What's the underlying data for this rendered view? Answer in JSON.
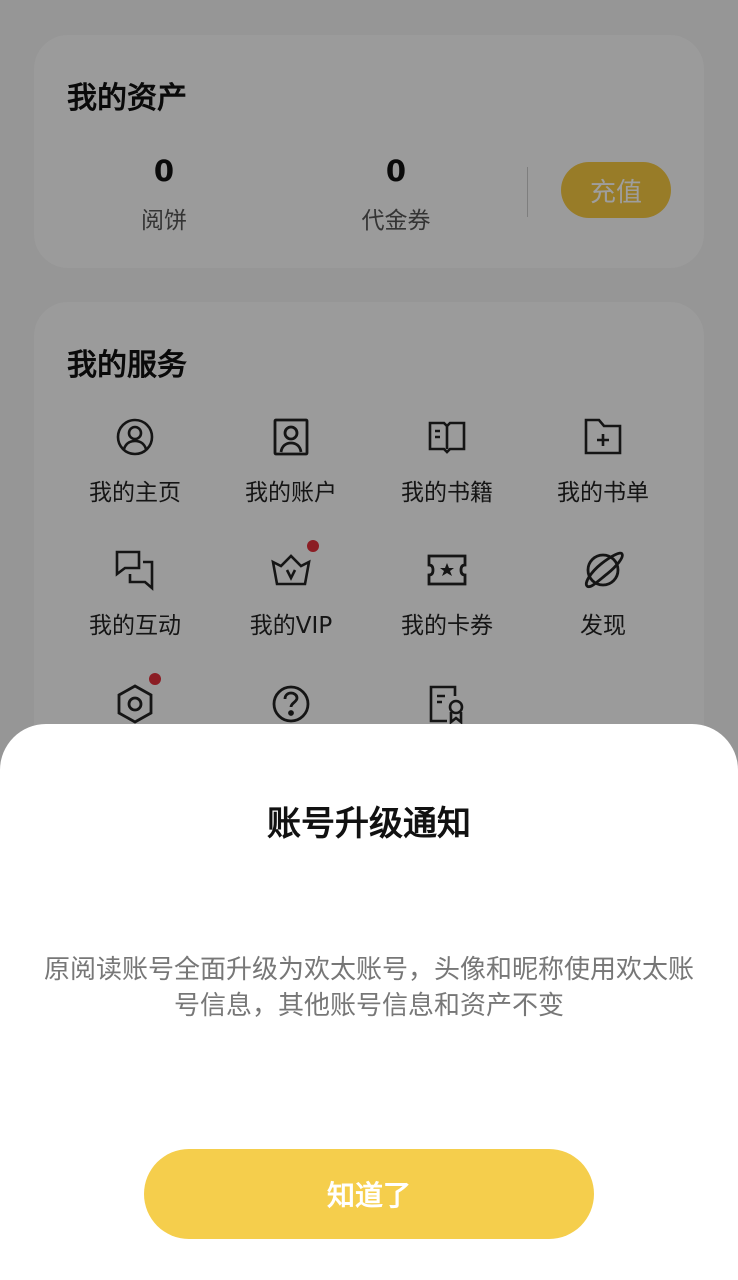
{
  "assets": {
    "title": "我的资产",
    "items": [
      {
        "value": "0",
        "label": "阅饼"
      },
      {
        "value": "0",
        "label": "代金券"
      }
    ],
    "recharge_label": "充值"
  },
  "services": {
    "title": "我的服务",
    "items": [
      {
        "label": "我的主页",
        "icon": "user-circle-icon",
        "badge": false
      },
      {
        "label": "我的账户",
        "icon": "account-card-icon",
        "badge": false
      },
      {
        "label": "我的书籍",
        "icon": "book-open-icon",
        "badge": false
      },
      {
        "label": "我的书单",
        "icon": "folder-plus-icon",
        "badge": false
      },
      {
        "label": "我的互动",
        "icon": "chat-bubbles-icon",
        "badge": false
      },
      {
        "label": "我的VIP",
        "icon": "vip-crown-icon",
        "badge": true
      },
      {
        "label": "我的卡券",
        "icon": "ticket-star-icon",
        "badge": false
      },
      {
        "label": "发现",
        "icon": "planet-icon",
        "badge": false
      },
      {
        "label": "",
        "icon": "settings-hex-icon",
        "badge": true
      },
      {
        "label": "",
        "icon": "help-circle-icon",
        "badge": false
      },
      {
        "label": "",
        "icon": "certificate-icon",
        "badge": false
      }
    ]
  },
  "dialog": {
    "title": "账号升级通知",
    "body": "原阅读账号全面升级为欢太账号，头像和昵称使用欢太账号信息，其他账号信息和资产不变",
    "confirm_label": "知道了"
  },
  "colors": {
    "accent": "#f5ce4c",
    "badge": "#e0303a"
  }
}
